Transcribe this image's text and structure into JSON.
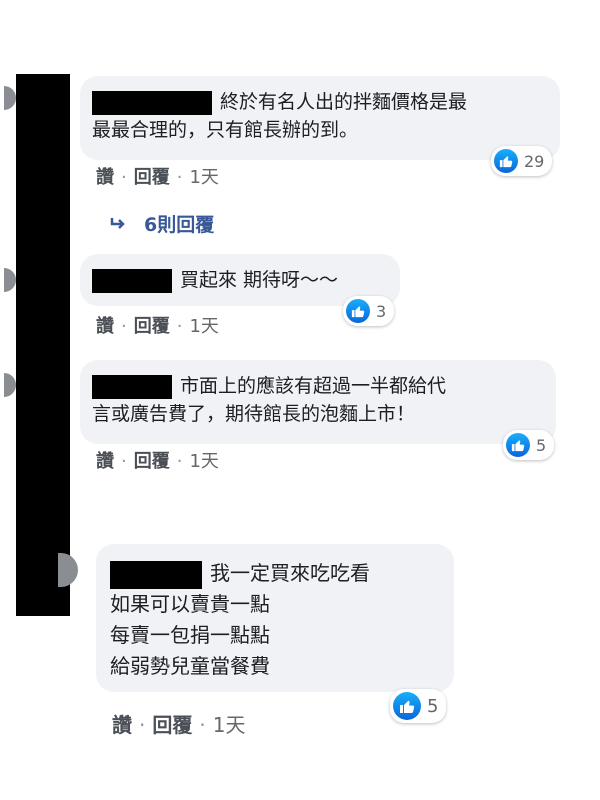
{
  "actions": {
    "like": "讚",
    "reply": "回覆",
    "time": "1天",
    "separator": "·"
  },
  "comments": [
    {
      "lines": [
        "終於有名人出的拌麵價格是最",
        "最最合理的，只有館長辦的到。"
      ],
      "likes": "29"
    },
    {
      "lines": [
        "買起來 期待呀～～"
      ],
      "likes": "3"
    },
    {
      "lines": [
        "市面上的應該有超過一半都給代",
        "言或廣告費了，期待館長的泡麵上市！"
      ],
      "likes": "5"
    },
    {
      "lines": [
        "我一定買來吃吃看",
        "如果可以賣貴一點",
        "每賣一包捐一點點",
        "給弱勢兒童當餐費"
      ],
      "likes": "5"
    }
  ],
  "replies_link": {
    "label": "6則回覆",
    "icon": "reply-arrow-icon"
  },
  "colors": {
    "bubble": "#f0f2f5",
    "like_blue": "#1877f2",
    "link": "#385898",
    "meta": "#65676b"
  }
}
